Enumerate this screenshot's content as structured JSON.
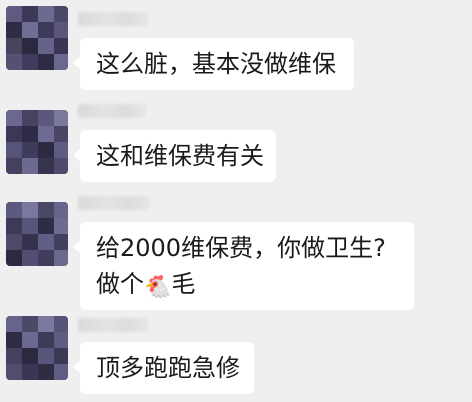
{
  "messages": [
    {
      "lines": [
        "这么脏，基本没做维保"
      ]
    },
    {
      "lines": [
        "这和维保费有关"
      ]
    },
    {
      "lines": [
        "给2000维保费，你做卫生?"
      ],
      "line2": {
        "before": "做个",
        "emoji": "🐔",
        "after": "毛"
      }
    },
    {
      "lines": [
        "顶多跑跑急修"
      ]
    }
  ],
  "colors": {
    "background": "#efefef",
    "bubble": "#ffffff",
    "text": "#1a1a1a"
  },
  "icons": {
    "emoji": "rooster-emoji"
  }
}
